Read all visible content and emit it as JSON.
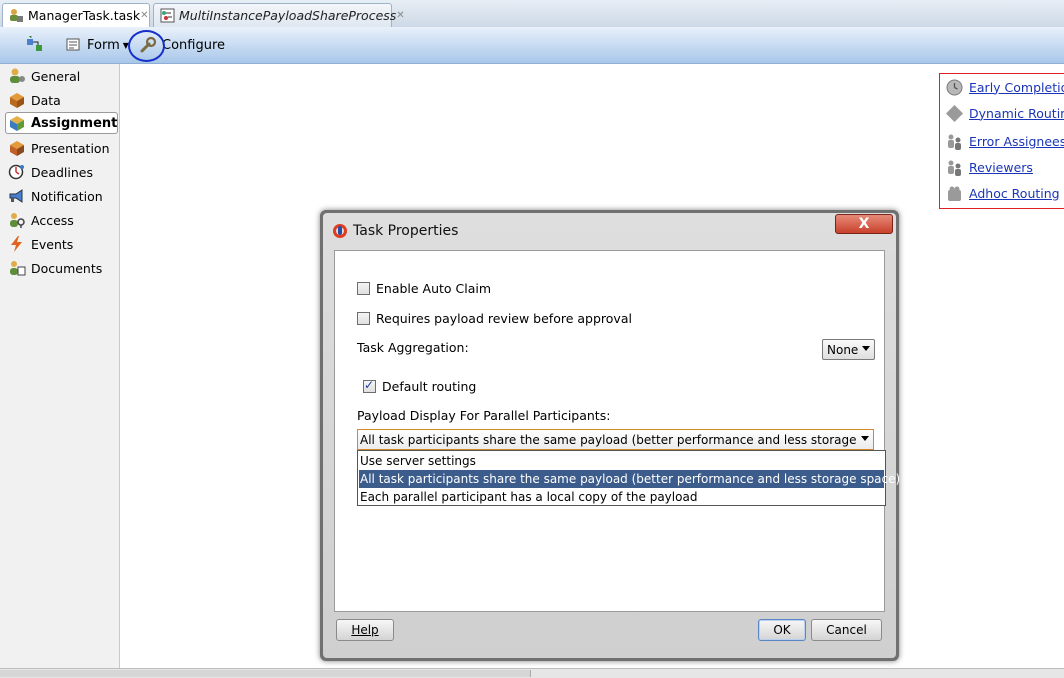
{
  "tabs": [
    {
      "label": "ManagerTask.task",
      "active": true
    },
    {
      "label": "MultiInstancePayloadShareProcess",
      "active": false
    }
  ],
  "toolbar": {
    "form_label": "Form",
    "configure_label": "Configure"
  },
  "leftnav": {
    "items": [
      {
        "label": "General",
        "icon": "general-icon"
      },
      {
        "label": "Data",
        "icon": "data-icon"
      },
      {
        "label": "Assignment",
        "icon": "assignment-icon",
        "selected": true
      },
      {
        "label": "Presentation",
        "icon": "presentation-icon"
      },
      {
        "label": "Deadlines",
        "icon": "deadlines-icon"
      },
      {
        "label": "Notification",
        "icon": "notification-icon"
      },
      {
        "label": "Access",
        "icon": "access-icon"
      },
      {
        "label": "Events",
        "icon": "events-icon"
      },
      {
        "label": "Documents",
        "icon": "documents-icon"
      }
    ]
  },
  "rightlinks": {
    "items": [
      {
        "label": "Early Completion",
        "icon": "clock-icon"
      },
      {
        "label": "Dynamic Routing",
        "icon": "diamond-icon"
      },
      {
        "label": "Error Assignees",
        "icon": "users-icon"
      },
      {
        "label": "Reviewers",
        "icon": "users-icon"
      },
      {
        "label": "Adhoc Routing",
        "icon": "puzzle-icon"
      }
    ]
  },
  "dialog": {
    "title": "Task Properties",
    "close_label": "X",
    "enable_auto_claim": {
      "label": "Enable Auto Claim",
      "checked": false
    },
    "requires_review": {
      "label": "Requires payload review before approval",
      "checked": false
    },
    "task_aggregation": {
      "label": "Task Aggregation:",
      "value": "None"
    },
    "default_routing": {
      "label": "Default routing",
      "checked": true
    },
    "payload_display": {
      "label": "Payload Display For Parallel Participants:",
      "value": "All task participants share the same payload (better performance and less storage sp...",
      "options": [
        "Use server settings",
        "All task participants share the same payload (better performance and less storage space)",
        "Each parallel participant has a local copy of the payload"
      ],
      "highlighted_index": 1
    },
    "help_label": "Help",
    "ok_label": "OK",
    "cancel_label": "Cancel"
  },
  "colors": {
    "toolbar_gradient_bottom": "#a8c7ea",
    "link_color": "#1a35b8",
    "annotation_circle": "#1530c9",
    "annotation_box": "#e02020",
    "selected_option_bg": "#3c5c8c",
    "close_button": "#c8412b"
  }
}
